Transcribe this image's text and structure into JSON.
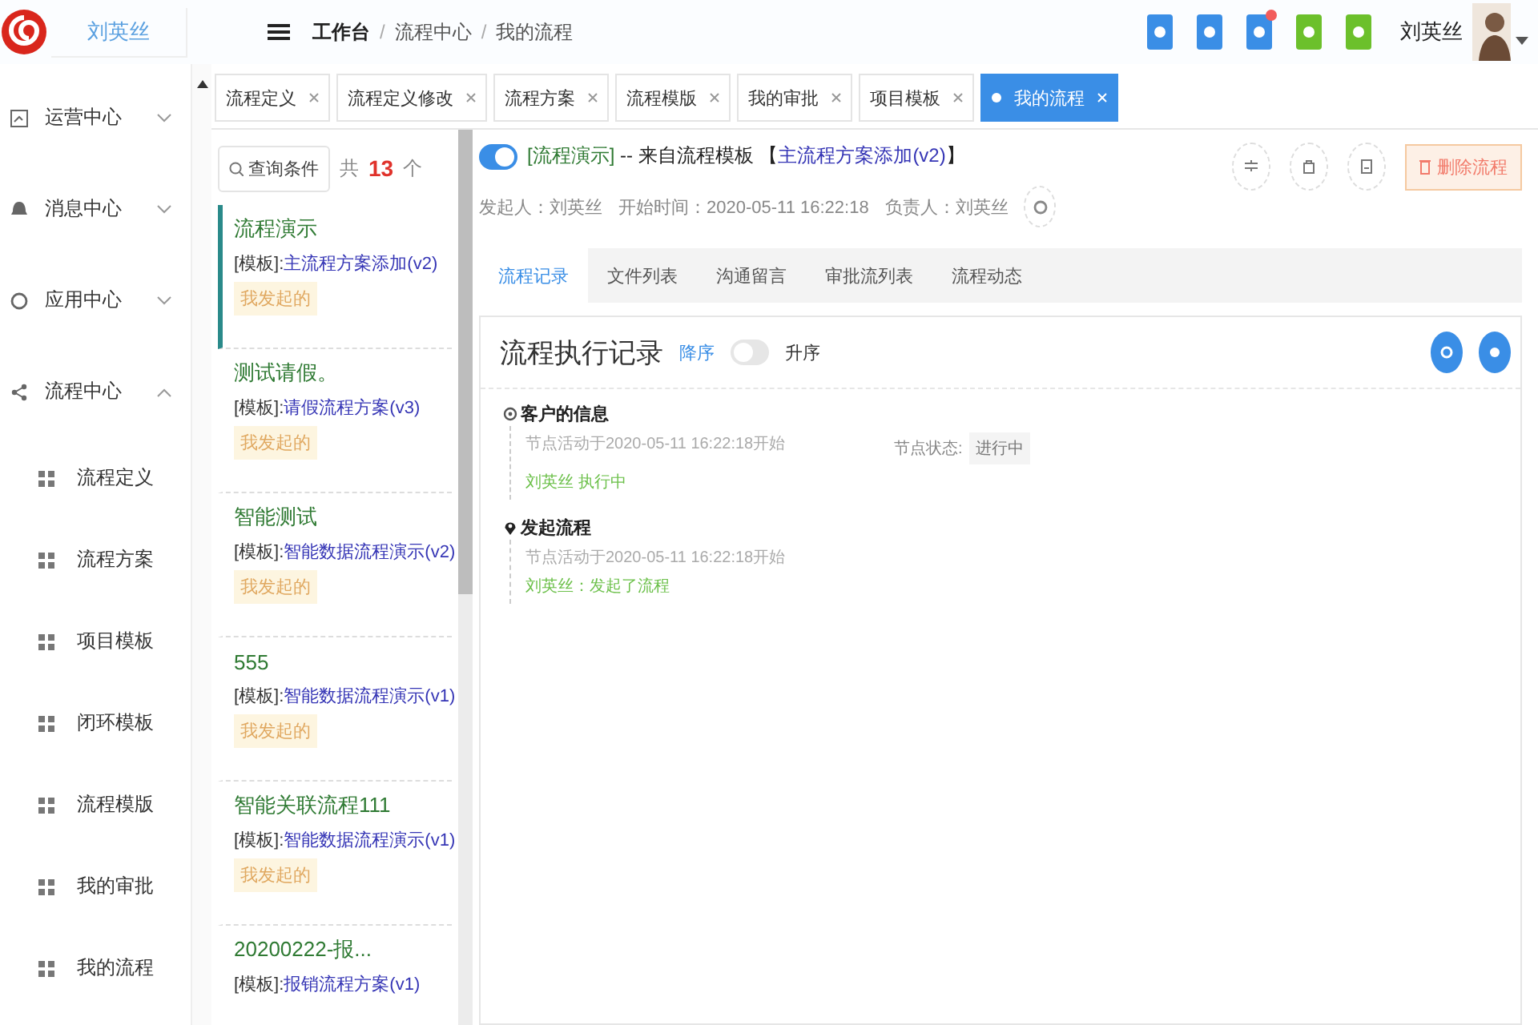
{
  "header": {
    "user_box": "刘英丝",
    "breadcrumb": [
      "工作台",
      "流程中心",
      "我的流程"
    ],
    "breadcrumb_separator": "/",
    "toolbar_icons": [
      {
        "color": "#3a8ee6",
        "alert": false
      },
      {
        "color": "#3a8ee6",
        "alert": false
      },
      {
        "color": "#3a8ee6",
        "alert": true
      },
      {
        "color": "#6cc02b",
        "alert": false
      },
      {
        "color": "#6cc02b",
        "alert": false
      }
    ],
    "user_name": "刘英丝"
  },
  "sidebar": {
    "items": [
      {
        "label": "运营中心",
        "expanded": false
      },
      {
        "label": "消息中心",
        "expanded": false
      },
      {
        "label": "应用中心",
        "expanded": false
      },
      {
        "label": "流程中心",
        "expanded": true,
        "children": [
          {
            "label": "流程定义"
          },
          {
            "label": "流程方案"
          },
          {
            "label": "项目模板"
          },
          {
            "label": "闭环模板"
          },
          {
            "label": "流程模版"
          },
          {
            "label": "我的审批"
          },
          {
            "label": "我的流程"
          }
        ]
      }
    ]
  },
  "tabs": [
    {
      "label": "流程定义",
      "selected": false
    },
    {
      "label": "流程定义修改",
      "selected": false
    },
    {
      "label": "流程方案",
      "selected": false
    },
    {
      "label": "流程模版",
      "selected": false
    },
    {
      "label": "我的审批",
      "selected": false
    },
    {
      "label": "项目模板",
      "selected": false
    },
    {
      "label": "我的流程",
      "selected": true
    }
  ],
  "list": {
    "search_button": "查询条件",
    "count_prefix": "共",
    "count": "13",
    "count_suffix": "个",
    "items": [
      {
        "title": "流程演示",
        "template_prefix": "[模板]:",
        "template": "主流程方案添加(v2)",
        "tag": "我发起的",
        "selected": true
      },
      {
        "title": "测试请假。",
        "template_prefix": "[模板]:",
        "template": "请假流程方案(v3)",
        "tag": "我发起的",
        "selected": false
      },
      {
        "title": "智能测试",
        "template_prefix": "[模板]:",
        "template": "智能数据流程演示(v2)",
        "tag": "我发起的",
        "selected": false
      },
      {
        "title": "555",
        "template_prefix": "[模板]:",
        "template": "智能数据流程演示(v1)",
        "tag": "我发起的",
        "selected": false
      },
      {
        "title": "智能关联流程111",
        "template_prefix": "[模板]:",
        "template": "智能数据流程演示(v1)",
        "tag": "我发起的",
        "selected": false
      },
      {
        "title": "20200222-报...",
        "template_prefix": "[模板]:",
        "template": "报销流程方案(v1)",
        "selected": false
      }
    ]
  },
  "detail": {
    "enabled": true,
    "title_tag": "[流程演示]",
    "title_text": "-- 来自流程模板",
    "source_open": "【",
    "source_name": "主流程方案添加(v2)",
    "source_close": "】",
    "meta": [
      "发起人：刘英丝",
      "开始时间：2020-05-11 16:22:18",
      "负责人：刘英丝"
    ],
    "delete_button": "删除流程",
    "tabs": [
      {
        "label": "流程记录",
        "selected": true
      },
      {
        "label": "文件列表",
        "selected": false
      },
      {
        "label": "沟通留言",
        "selected": false
      },
      {
        "label": "审批流列表",
        "selected": false
      },
      {
        "label": "流程动态",
        "selected": false
      }
    ],
    "record": {
      "title": "流程执行记录",
      "sort_desc": "降序",
      "sort_asc": "升序",
      "ascending": false,
      "nodes": [
        {
          "kind": "current",
          "name": "客户的信息",
          "time": "节点活动于2020-05-11 16:22:18开始",
          "actor": "刘英丝 执行中",
          "status_label": "节点状态:",
          "status": "进行中"
        },
        {
          "kind": "start",
          "name": "发起流程",
          "time": "节点活动于2020-05-11 16:22:18开始",
          "actor": "刘英丝：发起了流程"
        }
      ]
    }
  }
}
